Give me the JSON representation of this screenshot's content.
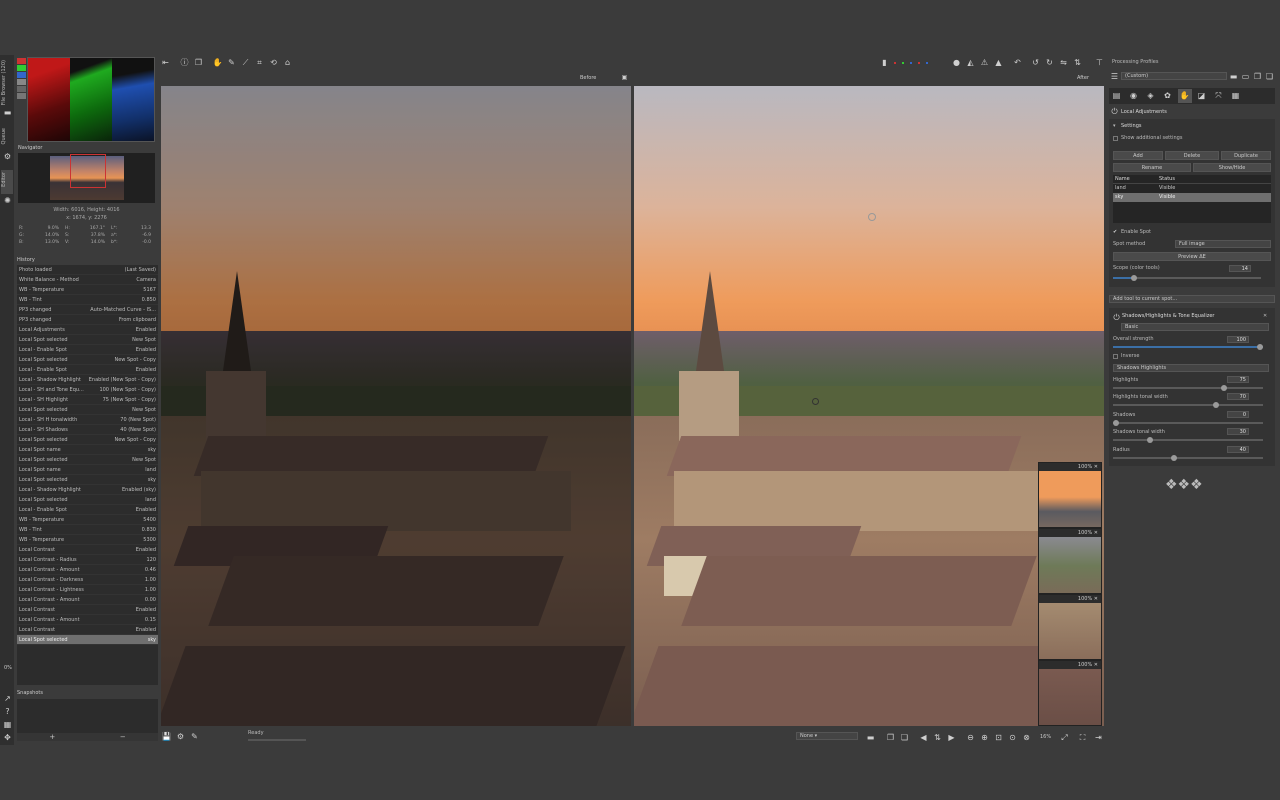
{
  "lefttabs": {
    "filebrowser": "File Browser (120)",
    "queue": "Queue",
    "editor": "Editor"
  },
  "navigator": {
    "title": "Navigator",
    "size": "Width: 6016, Height: 4016",
    "coords": "x: 1674, y: 2276",
    "rgb": [
      "R:",
      "G:",
      "B:"
    ],
    "rgbv": [
      "9.0%",
      "14.0%",
      "13.0%"
    ],
    "hsv": [
      "H:",
      "S:",
      "V:"
    ],
    "hsvv": [
      "167.1°",
      "37.8%",
      "14.0%"
    ],
    "lab": [
      "L*:",
      "a*:",
      "b*:"
    ],
    "labv": [
      "13.3",
      "-6.9",
      "-0.0"
    ]
  },
  "history": {
    "title": "History",
    "rows": [
      [
        "Photo loaded",
        "(Last Saved)"
      ],
      [
        "White Balance - Method",
        "Camera"
      ],
      [
        "WB - Temperature",
        "5167"
      ],
      [
        "WB - Tint",
        "0.850"
      ],
      [
        "PP3 changed",
        "Auto-Matched Curve - IS..."
      ],
      [
        "PP3 changed",
        "From clipboard"
      ],
      [
        "Local Adjustments",
        "Enabled"
      ],
      [
        "Local Spot selected",
        "New Spot"
      ],
      [
        "Local - Enable Spot",
        "Enabled"
      ],
      [
        "Local Spot selected",
        "New Spot - Copy"
      ],
      [
        "Local - Enable Spot",
        "Enabled"
      ],
      [
        "Local - Shadow Highlight",
        "Enabled (New Spot - Copy)"
      ],
      [
        "Local - SH and Tone Equ...",
        "100 (New Spot - Copy)"
      ],
      [
        "Local - SH Highlight",
        "75 (New Spot - Copy)"
      ],
      [
        "Local Spot selected",
        "New Spot"
      ],
      [
        "Local - SH H tonalwidth",
        "70 (New Spot)"
      ],
      [
        "Local - SH Shadows",
        "40 (New Spot)"
      ],
      [
        "Local Spot selected",
        "New Spot - Copy"
      ],
      [
        "Local Spot name",
        "sky"
      ],
      [
        "Local Spot selected",
        "New Spot"
      ],
      [
        "Local Spot name",
        "land"
      ],
      [
        "Local Spot selected",
        "sky"
      ],
      [
        "Local - Shadow Highlight",
        "Enabled (sky)"
      ],
      [
        "Local Spot selected",
        "land"
      ],
      [
        "Local - Enable Spot",
        "Enabled"
      ],
      [
        "WB - Temperature",
        "5400"
      ],
      [
        "WB - Tint",
        "0.830"
      ],
      [
        "WB - Temperature",
        "5300"
      ],
      [
        "Local Contrast",
        "Enabled"
      ],
      [
        "Local Contrast - Radius",
        "120"
      ],
      [
        "Local Contrast - Amount",
        "0.46"
      ],
      [
        "Local Contrast - Darkness",
        "1.00"
      ],
      [
        "Local Contrast - Lightness",
        "1.00"
      ],
      [
        "Local Contrast - Amount",
        "0.00"
      ],
      [
        "Local Contrast",
        "Enabled"
      ],
      [
        "Local Contrast - Amount",
        "0.15"
      ],
      [
        "Local Contrast",
        "Enabled"
      ],
      [
        "Local Spot selected",
        "sky"
      ]
    ]
  },
  "snapshots": {
    "title": "Snapshots",
    "add": "+",
    "remove": "−"
  },
  "left_percent": "0%",
  "labels": {
    "before": "Before",
    "after": "After"
  },
  "status": {
    "text": "Ready",
    "zoom": "16%",
    "mode": "None"
  },
  "details": {
    "zoom": "100%"
  },
  "right": {
    "profiles_title": "Processing Profiles",
    "profile": "(Custom)",
    "section": "Local Adjustments",
    "settings": "Settings",
    "show_additional": "Show additional settings",
    "buttons": {
      "add": "Add",
      "delete": "Delete",
      "duplicate": "Duplicate",
      "rename": "Rename",
      "showhide": "Show/Hide"
    },
    "spot_table": {
      "h_name": "Name",
      "h_status": "Status",
      "rows": [
        [
          "land",
          "Visible"
        ],
        [
          "sky",
          "Visible"
        ]
      ]
    },
    "enable_spot": "Enable Spot",
    "spot_method_label": "Spot method",
    "spot_method": "Full image",
    "preview": "Preview ΔE",
    "scope_label": "Scope (color tools)",
    "scope_value": "14",
    "add_tool": "Add tool to current spot...",
    "tool_title": "Shadows/Highlights & Tone Equalizer",
    "tool_mode": "Basic",
    "overall_label": "Overall strength",
    "overall_value": "100",
    "inverse": "Inverse",
    "sh_mode": "Shadows Highlights",
    "highlights_label": "Highlights",
    "highlights_value": "75",
    "hl_width_label": "Highlights tonal width",
    "hl_width_value": "70",
    "shadows_label": "Shadows",
    "shadows_value": "0",
    "sh_width_label": "Shadows tonal width",
    "sh_width_value": "30",
    "radius_label": "Radius",
    "radius_value": "40"
  }
}
